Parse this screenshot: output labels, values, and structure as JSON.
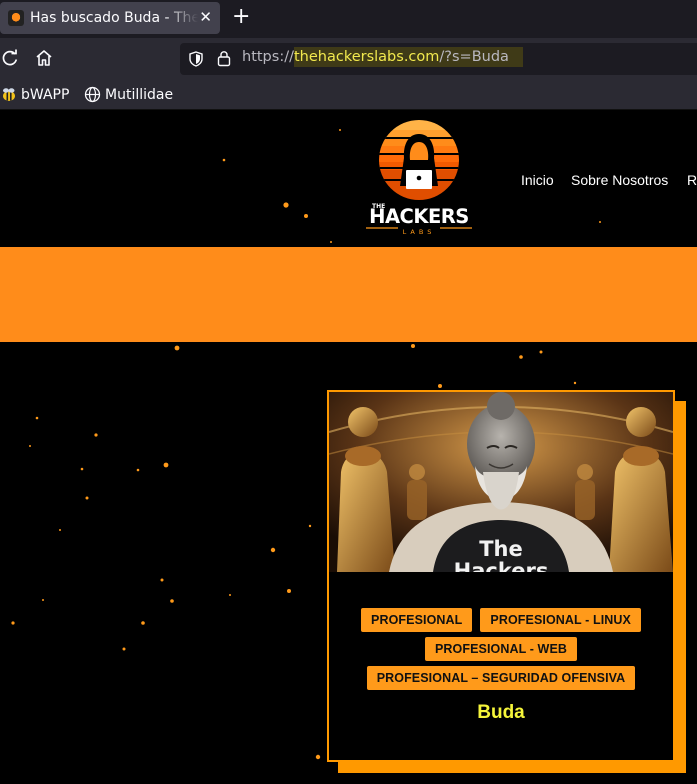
{
  "browser": {
    "tab": {
      "title": "Has buscado Buda - The H",
      "close_glyph": "✕"
    },
    "new_tab_glyph": "+",
    "url": {
      "protocol": "https://",
      "domain": "thehackerslabs.com",
      "path": "/?s=Buda"
    },
    "bookmarks": [
      {
        "label": "bWAPP",
        "icon": "bee-icon"
      },
      {
        "label": "Mutillidae",
        "icon": "globe-icon"
      }
    ]
  },
  "site": {
    "logo": {
      "line1": "THE",
      "line2": "HACKERS",
      "line3": "LABS"
    },
    "menu": [
      "Inicio",
      "Sobre Nosotros",
      "R"
    ],
    "colors": {
      "accent": "#ff9900",
      "band": "#ff8c1a",
      "title": "#f5f53a"
    }
  },
  "card": {
    "image_text": "The Hackers",
    "tags": [
      [
        "PROFESIONAL",
        "PROFESIONAL - LINUX"
      ],
      [
        "PROFESIONAL - WEB"
      ],
      [
        "PROFESIONAL – SEGURIDAD OFENSIVA"
      ]
    ],
    "title": "Buda"
  }
}
